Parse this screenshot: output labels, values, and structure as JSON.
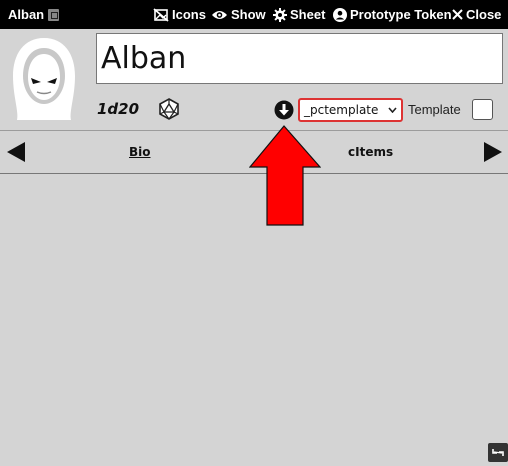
{
  "window": {
    "title": "Alban",
    "buttons": {
      "icons": "Icons",
      "show": "Show",
      "sheet": "Sheet",
      "prototype_token": "Prototype Token",
      "close": "Close"
    }
  },
  "character": {
    "name": "Alban",
    "formula": "1d20"
  },
  "template": {
    "selected": "_pctemplate",
    "label": "Template"
  },
  "tabs": [
    {
      "label": "Bio",
      "active": true
    },
    {
      "label": "cItems",
      "active": false
    }
  ],
  "colors": {
    "titlebar": "#000000",
    "background": "#d4d4d4",
    "annotation_arrow": "#ff0000",
    "select_border": "#dd3333"
  }
}
